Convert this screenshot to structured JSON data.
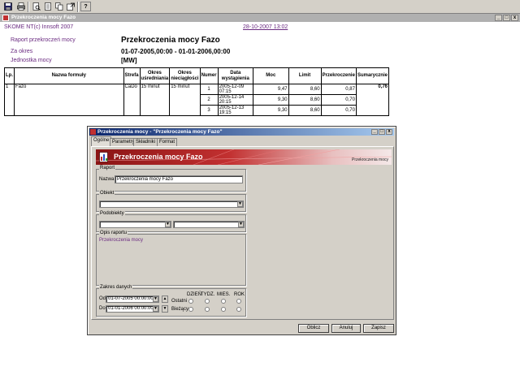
{
  "toolbar": {
    "icons": [
      "save-icon",
      "print-icon",
      "print-preview-icon",
      "page-setup-icon",
      "copy-icon",
      "export-icon",
      "help-icon"
    ],
    "help_glyph": "?"
  },
  "doc_window": {
    "title": "Przekroczenia mocy  Fazo",
    "min": "_",
    "max": "□",
    "close": "x"
  },
  "report": {
    "company": "SKOME NT(c) Innsoft 2007",
    "date": "28-10-2007 13:02",
    "label_report": "Raport przekroczeń mocy",
    "title": "Przekroczenia mocy  Fazo",
    "label_period": "Za okres",
    "period": "01-07-2005,00:00  -  01-01-2006,00:00",
    "label_unit": "Jednostka mocy",
    "unit": "[MW]"
  },
  "table": {
    "headers": {
      "lp": "Lp.",
      "formula": "Nazwa formuły",
      "zone": "Strefa",
      "avg_period": "Okres uśredniania",
      "dur_period": "Okres nieciągłości",
      "number": "Numer",
      "date": "Data wystąpienia",
      "power": "Moc",
      "limit": "Limit",
      "exceed": "Przekroczenie",
      "total": "Sumarycznie"
    },
    "group": {
      "lp": "1",
      "formula": "Fazo",
      "zone": "CaDo",
      "avg_period": "15 minut",
      "dur_period": "15 minut",
      "total": "0,76"
    },
    "rows": [
      {
        "number": "1",
        "date": "2005-12-09 07:15",
        "power": "9,47",
        "limit": "8,60",
        "exceed": "0,87"
      },
      {
        "number": "2",
        "date": "2005-12-14 20:15",
        "power": "9,30",
        "limit": "8,60",
        "exceed": "0,70"
      },
      {
        "number": "3",
        "date": "2005-12-13 19:15",
        "power": "9,30",
        "limit": "8,60",
        "exceed": "0,70"
      }
    ]
  },
  "dialog": {
    "title": "Przekroczenia mocy - \"Przekroczenia mocy  Fazo\"",
    "min": "_",
    "max": "□",
    "close": "x",
    "tabs": [
      "Ogólne",
      "Parametry",
      "Składniki",
      "Format"
    ],
    "banner_title": "Przekroczenia mocy  Fazo",
    "banner_logo": "Przekroczenia mocy",
    "group_report": "Raport",
    "label_name": "Nazwa",
    "name_value": "Przekroczenia mocy  Fazo",
    "group_object": "Obiekt",
    "object_value": "",
    "group_subobjects": "Podobiekty",
    "sub1_value": "",
    "sub2_value": "",
    "group_description": "Opis raportu",
    "description": "Przekroczenia mocy",
    "group_range": "Zakres danych",
    "label_from": "Od",
    "from_value": "01-07-2005 00:00:00",
    "label_to": "Do",
    "to_value": "01-01-2006 00:00:00",
    "period_day": "DZIEŃ",
    "period_week": "TYDZ.",
    "period_month": "MIES.",
    "period_year": "ROK",
    "label_last": "Ostatni",
    "label_current": "Bieżący",
    "btn_calc": "Oblicz",
    "btn_cancel": "Anuluj",
    "btn_save": "Zapisz"
  }
}
